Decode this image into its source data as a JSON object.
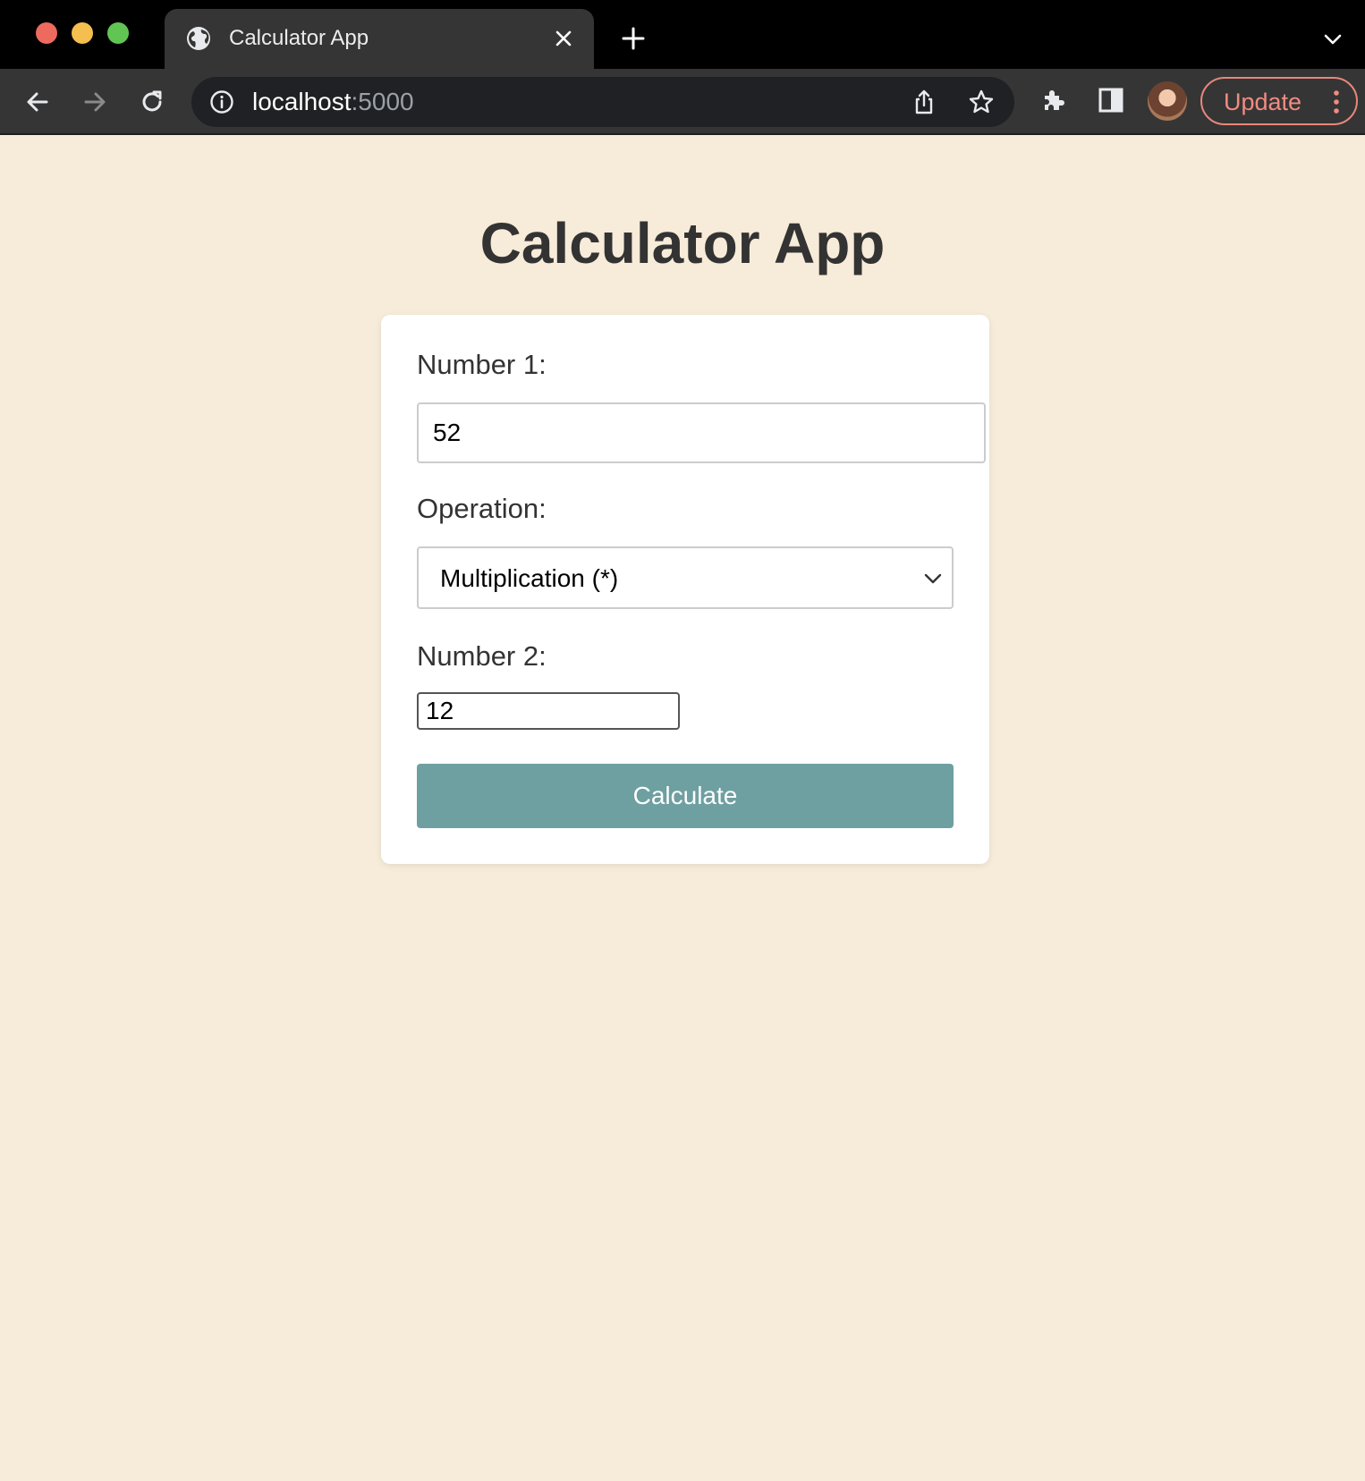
{
  "browser": {
    "tab": {
      "title": "Calculator App",
      "icon": "globe-icon"
    },
    "address_bar": {
      "host": "localhost",
      "port": ":5000"
    },
    "update_label": "Update",
    "colors": {
      "titlebar": "#000000",
      "toolbar": "#353535",
      "update_accent": "#f28b82"
    }
  },
  "page": {
    "title": "Calculator App",
    "form": {
      "number1": {
        "label": "Number 1:",
        "value": "52"
      },
      "operation": {
        "label": "Operation:",
        "selected": "Multiplication (*)"
      },
      "number2": {
        "label": "Number 2:",
        "value": "12"
      },
      "submit_label": "Calculate"
    },
    "colors": {
      "background": "#f7ebd9",
      "card": "#ffffff",
      "button": "#6e9fa1",
      "title_text": "#333333"
    }
  }
}
